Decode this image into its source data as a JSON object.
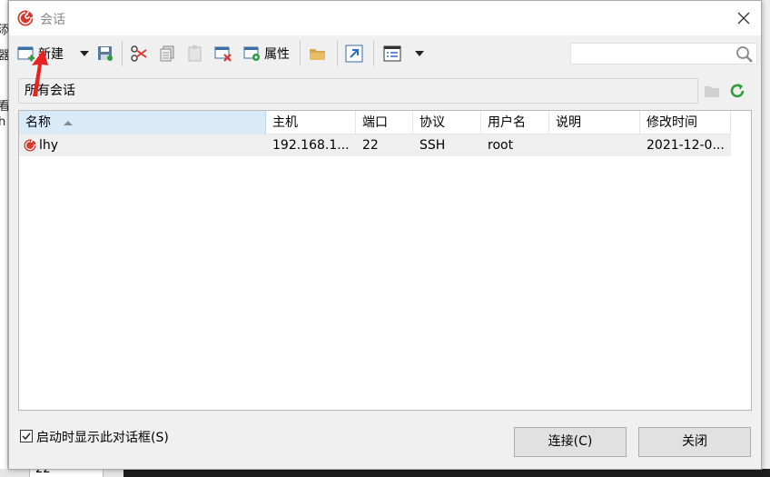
{
  "background": {
    "left_fragments": [
      "添",
      "器",
      "看",
      "h"
    ],
    "bottom_cell": "22"
  },
  "dialog": {
    "title": "会话",
    "toolbar": {
      "new_label": "新建",
      "properties_label": "属性",
      "search_placeholder": ""
    },
    "path": "所有会话",
    "table": {
      "columns": [
        "名称",
        "主机",
        "端口",
        "协议",
        "用户名",
        "说明",
        "修改时间"
      ],
      "sorted_column": "名称",
      "rows": [
        {
          "name": "lhy",
          "host": "192.168.1...",
          "port": "22",
          "protocol": "SSH",
          "user": "root",
          "description": "",
          "modified": "2021-12-0..."
        }
      ]
    },
    "startup_checkbox_label": "启动时显示此对话框(S)",
    "startup_checked": true,
    "connect_label": "连接(C)",
    "close_label": "关闭"
  },
  "colors": {
    "sorted_header": "#d9ebf9",
    "row_bg": "#efefef",
    "annotation": "#e8231f",
    "accent_green": "#2e9e3a"
  }
}
